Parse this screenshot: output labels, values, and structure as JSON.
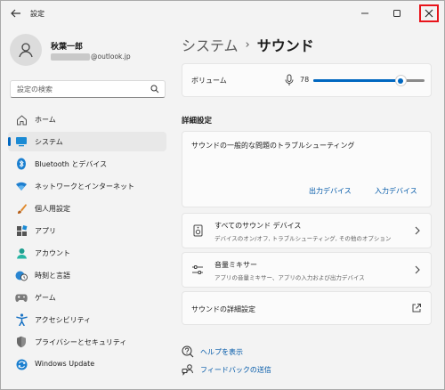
{
  "window": {
    "title": "設定",
    "min_icon": "minimize-icon",
    "max_icon": "maximize-icon",
    "close_icon": "close-icon"
  },
  "profile": {
    "name": "秋葉一郎",
    "email_suffix": "@outlook.jp",
    "avatar_icon": "person-icon"
  },
  "search": {
    "placeholder": "設定の検索",
    "icon": "search-icon"
  },
  "sidebar": {
    "items": [
      {
        "label": "ホーム",
        "icon": "home-icon",
        "active": false
      },
      {
        "label": "システム",
        "icon": "monitor-icon",
        "active": true
      },
      {
        "label": "Bluetooth とデバイス",
        "icon": "bluetooth-icon",
        "active": false
      },
      {
        "label": "ネットワークとインターネット",
        "icon": "wifi-icon",
        "active": false
      },
      {
        "label": "個人用設定",
        "icon": "brush-icon",
        "active": false
      },
      {
        "label": "アプリ",
        "icon": "apps-icon",
        "active": false
      },
      {
        "label": "アカウント",
        "icon": "account-icon",
        "active": false
      },
      {
        "label": "時刻と言語",
        "icon": "globe-clock-icon",
        "active": false
      },
      {
        "label": "ゲーム",
        "icon": "gamepad-icon",
        "active": false
      },
      {
        "label": "アクセシビリティ",
        "icon": "accessibility-icon",
        "active": false
      },
      {
        "label": "プライバシーとセキュリティ",
        "icon": "shield-icon",
        "active": false
      },
      {
        "label": "Windows Update",
        "icon": "update-icon",
        "active": false
      }
    ]
  },
  "main": {
    "breadcrumb": {
      "parent": "システム",
      "separator": "›",
      "current": "サウンド"
    },
    "volume": {
      "label": "ボリューム",
      "value": "78",
      "level": 0.78,
      "icon": "microphone-icon"
    },
    "section_title": "詳細設定",
    "troubleshoot": {
      "title": "サウンドの一般的な問題のトラブルシューティング",
      "output_link": "出力デバイス",
      "input_link": "入力デバイス"
    },
    "rows": {
      "all_devices": {
        "title": "すべてのサウンド デバイス",
        "subtitle": "デバイスのオン/オフ, トラブルシューティング, その他のオプション",
        "icon": "speaker-device-icon"
      },
      "mixer": {
        "title": "音量ミキサー",
        "subtitle": "アプリの音量ミキサー、アプリの入力および出力デバイス",
        "icon": "mixer-icon"
      },
      "advanced": {
        "title": "サウンドの詳細設定",
        "icon": "external-link-icon"
      }
    },
    "help": [
      {
        "label": "ヘルプを表示",
        "icon": "help-icon"
      },
      {
        "label": "フィードバックの送信",
        "icon": "feedback-icon"
      }
    ]
  },
  "colors": {
    "accent": "#0067c0",
    "close_highlight": "#e8141b",
    "link": "#0058a8"
  }
}
